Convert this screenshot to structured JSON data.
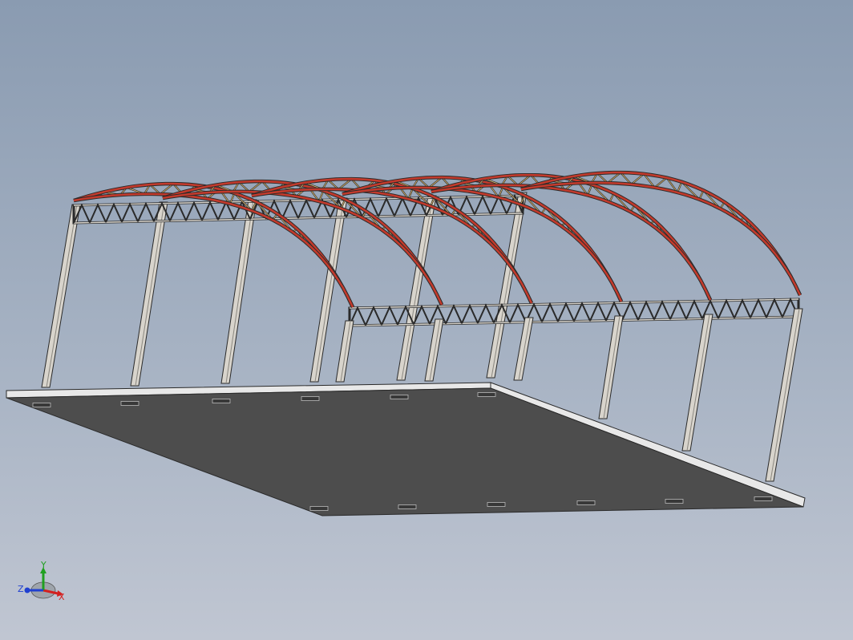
{
  "viewport": {
    "background_top": "#8a9bb1",
    "background_bottom": "#c0c6d2"
  },
  "model": {
    "truss_color": "#c23a2c",
    "truss_web_color": "#d9b36a",
    "steel_color": "#d8d4cc",
    "edge_color": "#2a2a2a",
    "base_top_color": "#4d4d4d",
    "base_side_color": "#e8e8e8"
  },
  "triad": {
    "x_label": "X",
    "y_label": "Y",
    "z_label": "Z",
    "x_color": "#d42020",
    "y_color": "#20a020",
    "z_color": "#2040d0"
  }
}
